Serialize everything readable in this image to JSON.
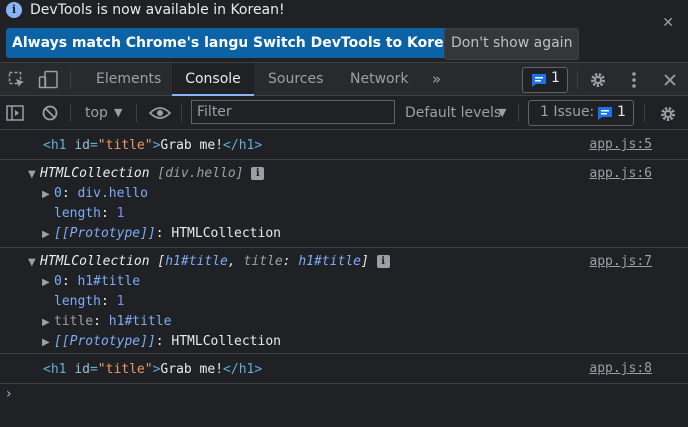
{
  "banner": {
    "message": "DevTools is now available in Korean!",
    "buttons": [
      "Always match Chrome's language",
      "Switch DevTools to Korean",
      "Don't show again"
    ],
    "close": "✕"
  },
  "tabs": [
    "Elements",
    "Console",
    "Sources",
    "Network"
  ],
  "tabs_more": "»",
  "messages_badge": "1",
  "toolbar": {
    "context": "top",
    "filter_placeholder": "Filter",
    "levels": "Default levels",
    "issues": "1 Issue:",
    "issues_count": "1"
  },
  "console": {
    "entry1": {
      "source": "app.js:5",
      "open": "<h1 ",
      "attr": "id",
      "eq": "=",
      "value": "\"title\"",
      "close_open": ">",
      "text": "Grab me!",
      "end": "</h1>"
    },
    "entry2": {
      "source": "app.js:6",
      "type": "HTMLCollection",
      "summary": "[div.hello]",
      "items": [
        {
          "key": "0",
          "value": "div.hello"
        },
        {
          "key": "length",
          "value": "1"
        },
        {
          "key": "[[Prototype]]",
          "value": "HTMLCollection"
        }
      ]
    },
    "entry3": {
      "source": "app.js:7",
      "type": "HTMLCollection",
      "summary_open": "[",
      "summary_a": "h1#title",
      "summary_sep": ", ",
      "summary_key": "title",
      "summary_colon": ": ",
      "summary_b": "h1#title",
      "summary_close": "]",
      "items": [
        {
          "key": "0",
          "value": "h1#title"
        },
        {
          "key": "length",
          "value": "1"
        },
        {
          "key": "title",
          "value": "h1#title"
        },
        {
          "key": "[[Prototype]]",
          "value": "HTMLCollection"
        }
      ]
    },
    "entry4": {
      "source": "app.js:8",
      "open": "<h1 ",
      "attr": "id",
      "eq": "=",
      "value": "\"title\"",
      "close_open": ">",
      "text": "Grab me!",
      "end": "</h1>"
    },
    "prompt": "›"
  },
  "colors": {
    "background": "#202124",
    "accent_button": "#0b63a5",
    "link_blue": "#8ab4f8",
    "tag": "#5db0d7",
    "number": "#9980ff"
  },
  "icons": [
    "info-icon",
    "close-icon",
    "inspect-element-icon",
    "device-toolbar-icon",
    "messages-icon",
    "settings-gear-icon",
    "more-vertical-icon",
    "sidebar-toggle-icon",
    "clear-console-icon",
    "eye-icon",
    "issues-icon"
  ]
}
